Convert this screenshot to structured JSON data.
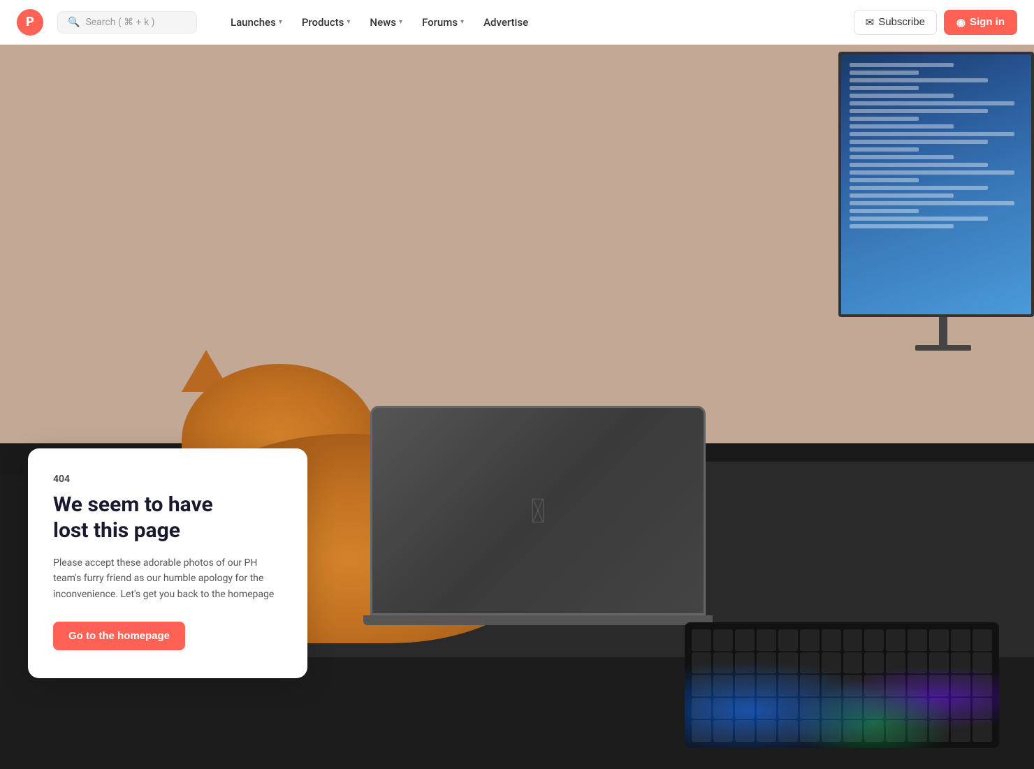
{
  "nav": {
    "logo_letter": "P",
    "search_placeholder": "Search ( ⌘ + k )",
    "links": [
      {
        "id": "launches",
        "label": "Launches",
        "has_chevron": true
      },
      {
        "id": "products",
        "label": "Products",
        "has_chevron": true
      },
      {
        "id": "news",
        "label": "News",
        "has_chevron": true
      },
      {
        "id": "forums",
        "label": "Forums",
        "has_chevron": true
      },
      {
        "id": "advertise",
        "label": "Advertise",
        "has_chevron": false
      }
    ],
    "subscribe_label": "Subscribe",
    "signin_label": "Sign in"
  },
  "error": {
    "code": "404",
    "title": "We seem to have\nlost this page",
    "description": "Please accept these adorable photos of our PH team's furry friend as our humble apology for the inconvenience. Let's get you back to the homepage",
    "cta_label": "Go to the homepage"
  },
  "colors": {
    "brand_red": "#ff6154",
    "wall_color": "#c4a896",
    "desk_color": "#1c1c1c"
  }
}
